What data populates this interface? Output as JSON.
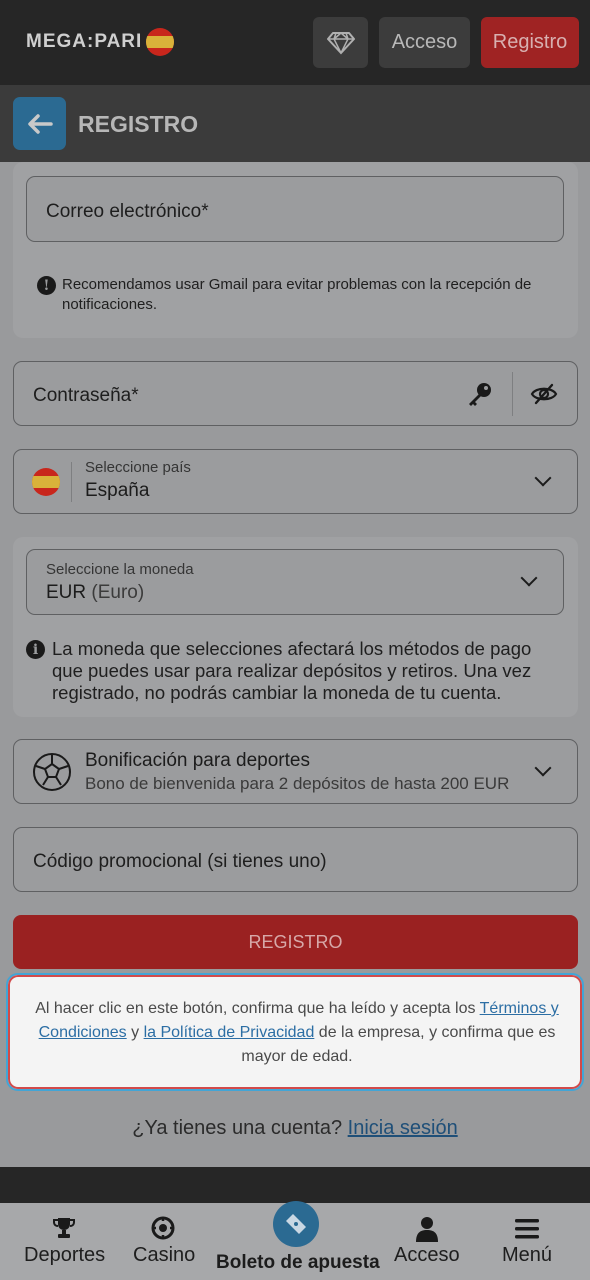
{
  "header": {
    "logo_text": "MEGA:PARI",
    "login_label": "Acceso",
    "register_label": "Registro"
  },
  "subheader": {
    "title": "REGISTRO"
  },
  "form": {
    "email_placeholder": "Correo electrónico*",
    "email_notice": "Recomendamos usar Gmail para evitar problemas con la recepción de notificaciones.",
    "password_placeholder": "Contraseña*",
    "country_label": "Seleccione país",
    "country_value": "España",
    "currency_label": "Seleccione la moneda",
    "currency_code": "EUR",
    "currency_name": "(Euro)",
    "currency_notice": "La moneda que selecciones afectará los métodos de pago que puedes usar para realizar depósitos y retiros. Una vez registrado, no podrás cambiar la moneda de tu cuenta.",
    "bonus_title": "Bonificación para deportes",
    "bonus_subtitle": "Bono de bienvenida para 2 depósitos de hasta 200 EUR",
    "promo_placeholder": "Código promocional (si tienes uno)",
    "submit_label": "REGISTRO"
  },
  "terms": {
    "text_before": "Al hacer clic en este botón, confirma que ha leído y acepta los ",
    "terms_link": "Términos y Condiciones",
    "text_middle": " y ",
    "privacy_link": "la Política de Privacidad",
    "text_after": " de la empresa, y confirma que es mayor de edad."
  },
  "login_prompt": {
    "question": "¿Ya tienes una cuenta? ",
    "link": "Inicia sesión"
  },
  "bottom_nav": {
    "sports": "Deportes",
    "casino": "Casino",
    "betslip": "Boleto de apuesta",
    "login": "Acceso",
    "menu": "Menú"
  },
  "colors": {
    "brand_red": "#9f2323",
    "accent_blue": "#2b6a92",
    "link_blue": "#2c6ea4"
  }
}
